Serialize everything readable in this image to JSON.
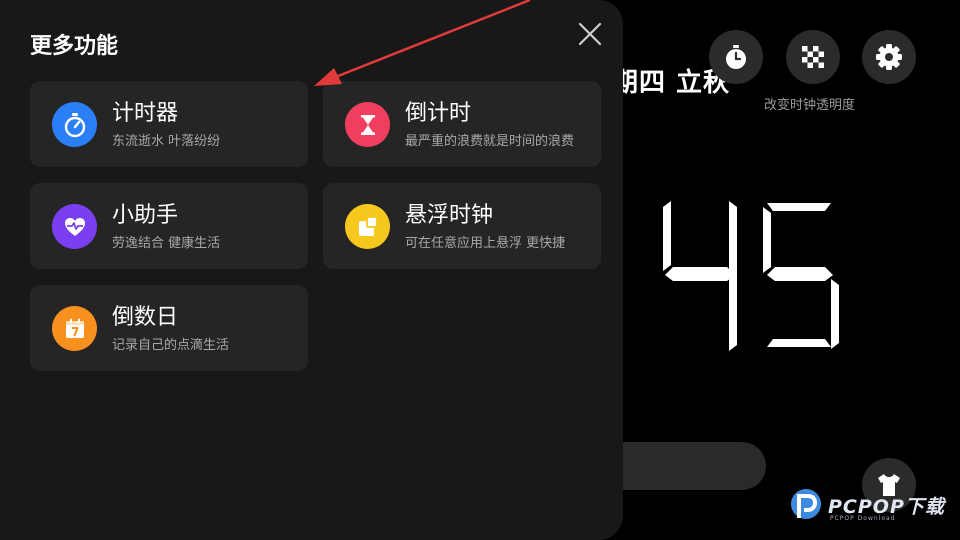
{
  "background": {
    "date_text": "期四 立秋",
    "opacity_label": "改变时钟透明度",
    "clock_value": "45",
    "buttons": [
      {
        "name": "stopwatch-icon"
      },
      {
        "name": "checkerboard-icon"
      },
      {
        "name": "gear-icon"
      }
    ]
  },
  "panel": {
    "title": "更多功能",
    "cards": [
      {
        "title": "计时器",
        "subtitle": "东流逝水 叶落纷纷",
        "icon": "stopwatch-icon",
        "color": "#2b7ff5"
      },
      {
        "title": "倒计时",
        "subtitle": "最严重的浪费就是时间的浪费",
        "icon": "hourglass-icon",
        "color": "#f03e5f"
      },
      {
        "title": "小助手",
        "subtitle": "劳逸结合 健康生活",
        "icon": "heart-pulse-icon",
        "color": "#7b3ff2"
      },
      {
        "title": "悬浮时钟",
        "subtitle": "可在任意应用上悬浮 更快捷",
        "icon": "floating-window-icon",
        "color": "#f6c81d"
      },
      {
        "title": "倒数日",
        "subtitle": "记录自己的点滴生活",
        "icon": "calendar-icon",
        "color": "#f7901e"
      }
    ]
  },
  "watermark": {
    "text": "PCPOP下载",
    "sub": "PCPOP Download"
  },
  "colors": {
    "panel_bg": "#181818",
    "card_bg": "#252525",
    "annotation_arrow": "#e03a3a"
  }
}
